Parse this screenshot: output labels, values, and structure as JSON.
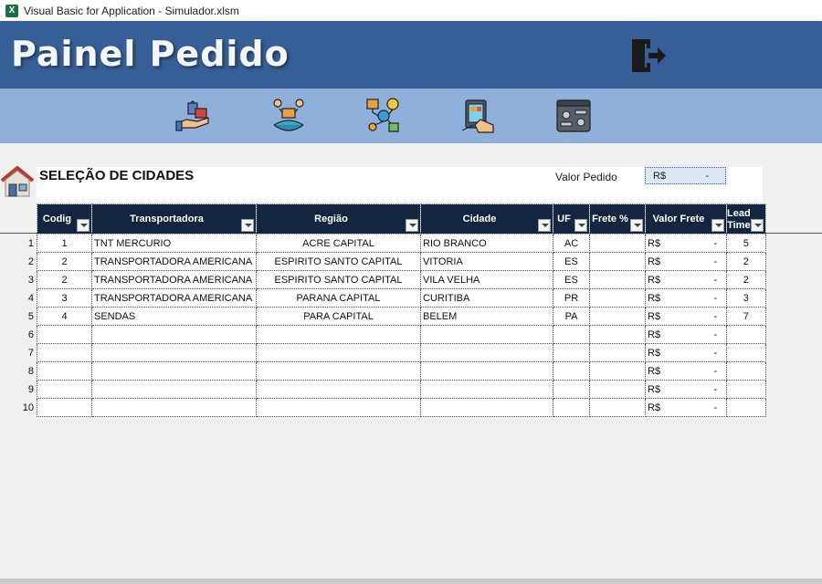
{
  "window": {
    "title": "Visual Basic for Application - Simulador.xlsm"
  },
  "header": {
    "title": "Painel Pedido"
  },
  "section": {
    "title": "SELEÇÃO DE CIDADES",
    "valor_label": "Valor Pedido",
    "valor_currency": "R$",
    "valor_value": "-"
  },
  "table": {
    "columns": [
      "Codig",
      "Transportadora",
      "Região",
      "Cidade",
      "UF",
      "Frete %",
      "Valor Frete",
      "Lead Time"
    ],
    "rows": [
      {
        "n": "1",
        "codigo": "1",
        "transportadora": "TNT MERCURIO",
        "regiao": "ACRE CAPITAL",
        "cidade": "RIO BRANCO",
        "uf": "AC",
        "frete": "",
        "valor_currency": "R$",
        "valor": "-",
        "lead": "5"
      },
      {
        "n": "2",
        "codigo": "2",
        "transportadora": "TRANSPORTADORA AMERICANA",
        "regiao": "ESPIRITO SANTO CAPITAL",
        "cidade": "VITORIA",
        "uf": "ES",
        "frete": "",
        "valor_currency": "R$",
        "valor": "-",
        "lead": "2"
      },
      {
        "n": "3",
        "codigo": "2",
        "transportadora": "TRANSPORTADORA AMERICANA",
        "regiao": "ESPIRITO SANTO CAPITAL",
        "cidade": "VILA VELHA",
        "uf": "ES",
        "frete": "",
        "valor_currency": "R$",
        "valor": "-",
        "lead": "2"
      },
      {
        "n": "4",
        "codigo": "3",
        "transportadora": "TRANSPORTADORA AMERICANA",
        "regiao": "PARANA CAPITAL",
        "cidade": "CURITIBA",
        "uf": "PR",
        "frete": "",
        "valor_currency": "R$",
        "valor": "-",
        "lead": "3"
      },
      {
        "n": "5",
        "codigo": "4",
        "transportadora": "SENDAS",
        "regiao": "PARA CAPITAL",
        "cidade": "BELEM",
        "uf": "PA",
        "frete": "",
        "valor_currency": "R$",
        "valor": "-",
        "lead": "7"
      },
      {
        "n": "6",
        "codigo": "",
        "transportadora": "",
        "regiao": "",
        "cidade": "",
        "uf": "",
        "frete": "",
        "valor_currency": "R$",
        "valor": "-",
        "lead": ""
      },
      {
        "n": "7",
        "codigo": "",
        "transportadora": "",
        "regiao": "",
        "cidade": "",
        "uf": "",
        "frete": "",
        "valor_currency": "R$",
        "valor": "-",
        "lead": ""
      },
      {
        "n": "8",
        "codigo": "",
        "transportadora": "",
        "regiao": "",
        "cidade": "",
        "uf": "",
        "frete": "",
        "valor_currency": "R$",
        "valor": "-",
        "lead": ""
      },
      {
        "n": "9",
        "codigo": "",
        "transportadora": "",
        "regiao": "",
        "cidade": "",
        "uf": "",
        "frete": "",
        "valor_currency": "R$",
        "valor": "-",
        "lead": ""
      },
      {
        "n": "10",
        "codigo": "",
        "transportadora": "",
        "regiao": "",
        "cidade": "",
        "uf": "",
        "frete": "",
        "valor_currency": "R$",
        "valor": "-",
        "lead": ""
      }
    ]
  },
  "icons": {
    "app": "excel-icon",
    "exit": "exit-door-icon",
    "home": "home-icon",
    "toolbar": [
      "order-delivery-icon",
      "distribution-network-icon",
      "logistics-flow-icon",
      "tablet-order-icon",
      "control-panel-icon"
    ]
  },
  "colors": {
    "header": "#365f97",
    "toolbar": "#8fb0db",
    "table_header": "#13253f",
    "accent_orange": "#f0a030"
  }
}
